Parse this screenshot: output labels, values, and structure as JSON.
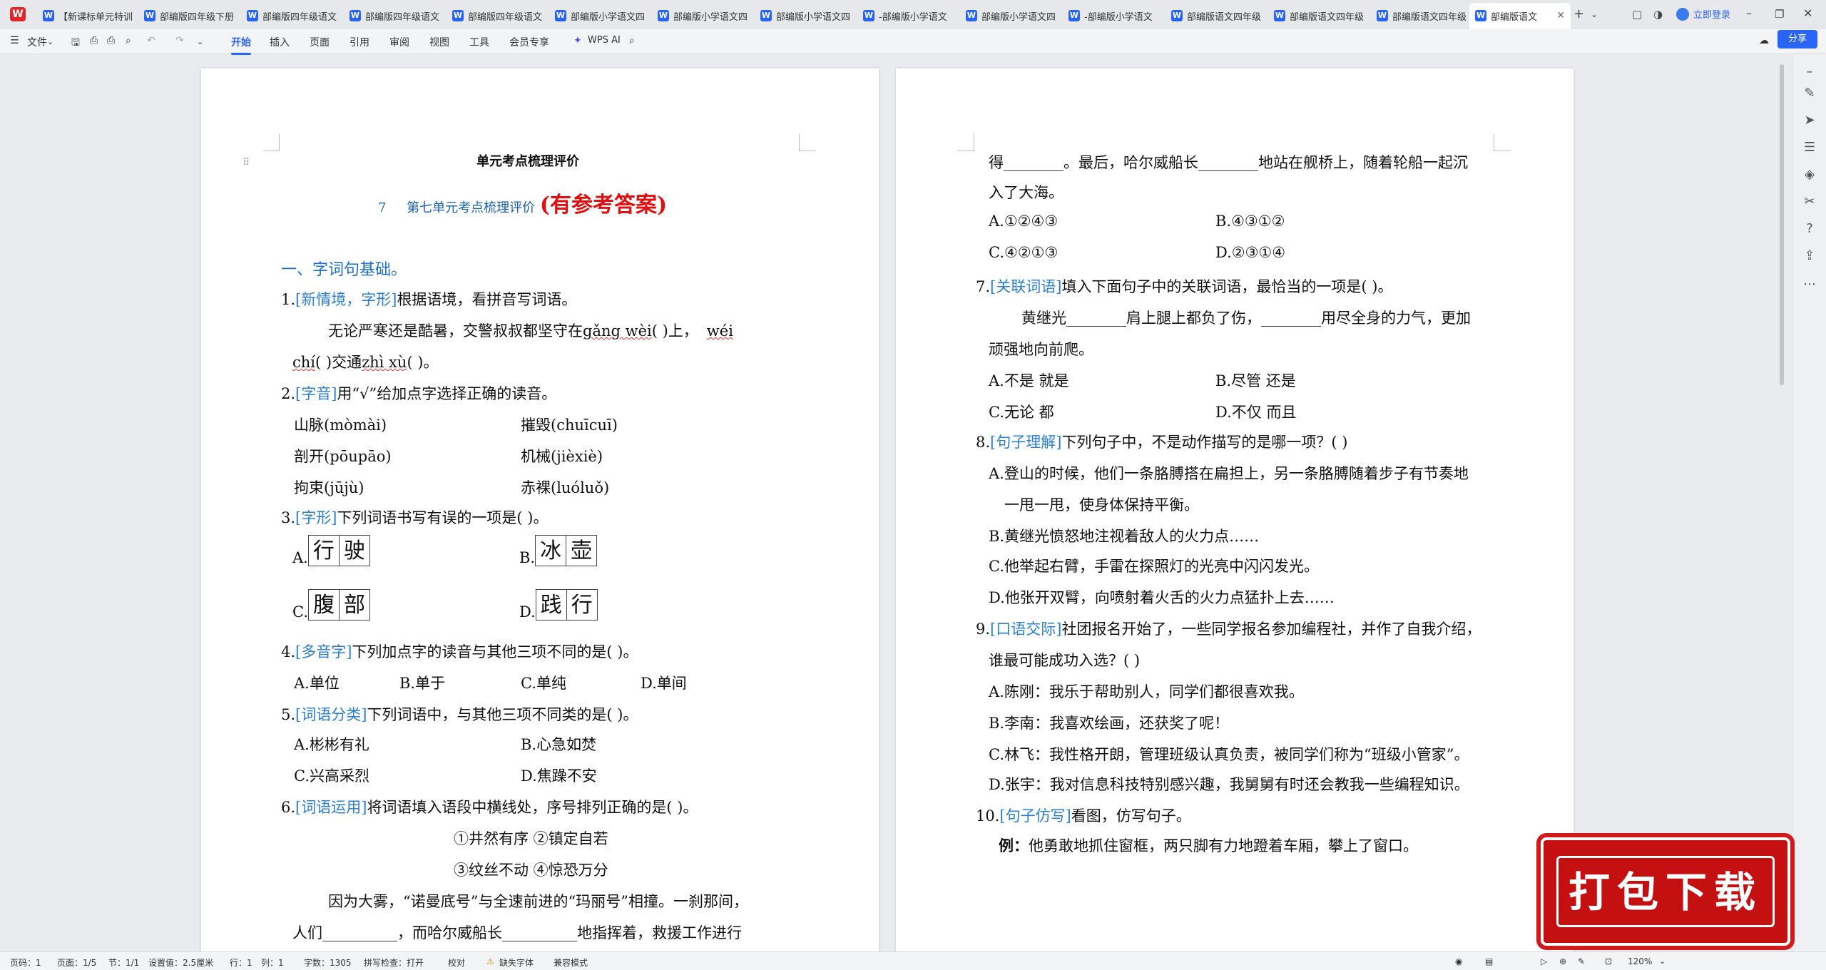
{
  "tabs": [
    "【新课标单元特训",
    "部编版四年级下册",
    "部编版四年级语文",
    "部编版四年级语文",
    "部编版四年级语文",
    "部编版小学语文四",
    "部编版小学语文四",
    "部编版小学语文四",
    "-部编版小学语文",
    "部编版小学语文四",
    "-部编版小学语文",
    "部编版语文四年级",
    "部编版语文四年级",
    "部编版语文四年级",
    "部编版语文"
  ],
  "login": "立即登录",
  "ribbon": {
    "file": "文件",
    "tabs": [
      "开始",
      "插入",
      "页面",
      "引用",
      "审阅",
      "视图",
      "工具",
      "会员专享"
    ],
    "ai": "WPS AI"
  },
  "share": "分享",
  "page1": {
    "header": "单元考点梳理评价",
    "title_num": "7",
    "title_text": "第七单元考点梳理评价",
    "title_red": "(有参考答案)",
    "sec1": "一、字词句基础。",
    "q1_num": "1.",
    "q1_tag": "[新情境，字形]",
    "q1_text": "根据语境，看拼音写词语。",
    "q1_l1a": "无论严寒还是酷暑，交警叔叔都坚守在",
    "q1_p1": "gǎng wèi",
    "q1_l1b": "(           )上，",
    "q1_p2": "wéi",
    "q1_p2b": "chí",
    "q1_l2a": "(          )交通",
    "q1_p3": "zhì xù",
    "q1_l2b": "(          )。",
    "q2_num": "2.",
    "q2_tag": "[字音]",
    "q2_text": "用“√”给加点字选择正确的读音。",
    "q2_items": [
      "山脉(mòmài)",
      "摧毁(chuīcuī)",
      "剖开(pōupāo)",
      "机械(jièxiè)",
      "拘束(jūjù)",
      "赤裸(luóluǒ)"
    ],
    "q3_num": "3.",
    "q3_tag": "[字形]",
    "q3_text": "下列词语书写有误的一项是(        )。",
    "q3_opts": [
      {
        "k": "A.",
        "c": [
          "行",
          "驶"
        ]
      },
      {
        "k": "B.",
        "c": [
          "冰",
          "壶"
        ]
      },
      {
        "k": "C.",
        "c": [
          "腹",
          "部"
        ]
      },
      {
        "k": "D.",
        "c": [
          "践",
          "行"
        ]
      }
    ],
    "q4_num": "4.",
    "q4_tag": "[多音字]",
    "q4_text": "下列加点字的读音与其他三项不同的是(        )。",
    "q4_opts": [
      "A.单位",
      "B.单于",
      "C.单纯",
      "D.单间"
    ],
    "q5_num": "5.",
    "q5_tag": "[词语分类]",
    "q5_text": "下列词语中，与其他三项不同类的是(        )。",
    "q5_opts": [
      "A.彬彬有礼",
      "B.心急如焚",
      "C.兴高采烈",
      "D.焦躁不安"
    ],
    "q6_num": "6.",
    "q6_tag": "[词语运用]",
    "q6_text": "将词语填入语段中横线处，序号排列正确的是(        )。",
    "q6_words1": "①井然有序    ②镇定自若",
    "q6_words2": "③纹丝不动    ④惊恐万分",
    "q6_para1": "因为大雾，“诺曼底号”与全速前进的“玛丽号”相撞。一刹那间，",
    "q6_para2": "人们__________，而哈尔威船长__________地指挥着，救援工作进行"
  },
  "page2": {
    "l1": "得________。最后，哈尔威船长________地站在舰桥上，随着轮船一起沉",
    "l2": "入了大海。",
    "q6_opts": [
      "A.①②④③",
      "B.④③①②",
      "C.④②①③",
      "D.②③①④"
    ],
    "q7_num": "7.",
    "q7_tag": "[关联词语]",
    "q7_text": "填入下面句子中的关联词语，最恰当的一项是(        )。",
    "q7_s1": "黄继光________肩上腿上都负了伤，________用尽全身的力气，更加",
    "q7_s2": "顽强地向前爬。",
    "q7_opts": [
      "A.不是    就是",
      "B.尽管    还是",
      "C.无论    都",
      "D.不仅    而且"
    ],
    "q8_num": "8.",
    "q8_tag": "[句子理解]",
    "q8_text": "下列句子中，不是动作描写的是哪一项？(        )",
    "q8_a1": "A.登山的时候，他们一条胳膊搭在扁担上，另一条胳膊随着步子有节奏地",
    "q8_a2": "一甩一甩，使身体保持平衡。",
    "q8_b": "B.黄继光愤怒地注视着敌人的火力点……",
    "q8_c": "C.他举起右臂，手雷在探照灯的光亮中闪闪发光。",
    "q8_d": "D.他张开双臂，向喷射着火舌的火力点猛扑上去……",
    "q9_num": "9.",
    "q9_tag": "[口语交际]",
    "q9_text": "社团报名开始了，一些同学报名参加编程社，并作了自我介绍，",
    "q9_text2": "谁最可能成功入选？(        )",
    "q9_a": "A.陈刚：我乐于帮助别人，同学们都很喜欢我。",
    "q9_b": "B.李南：我喜欢绘画，还获奖了呢！",
    "q9_c": "C.林飞：我性格开朗，管理班级认真负责，被同学们称为“班级小管家”。",
    "q9_d": "D.张宇：我对信息科技特别感兴趣，我舅舅有时还会教我一些编程知识。",
    "q10_num": "10.",
    "q10_tag": "[句子仿写]",
    "q10_text": "看图，仿写句子。",
    "q10_ex_lbl": "例：",
    "q10_ex": "他勇敢地抓住窗框，两只脚有力地蹬着车厢，攀上了窗口。"
  },
  "promo": "打包下载",
  "status": {
    "page": "页码：1",
    "pages": "页面：1/5",
    "section": "节：1/1",
    "setting": "设置值：2.5厘米",
    "row": "行：1",
    "col": "列：1",
    "words": "字数：1305",
    "spell": "拼写检查：打开",
    "proof": "校对",
    "font": "缺失字体",
    "compat": "兼容模式",
    "zoom": "120%"
  }
}
